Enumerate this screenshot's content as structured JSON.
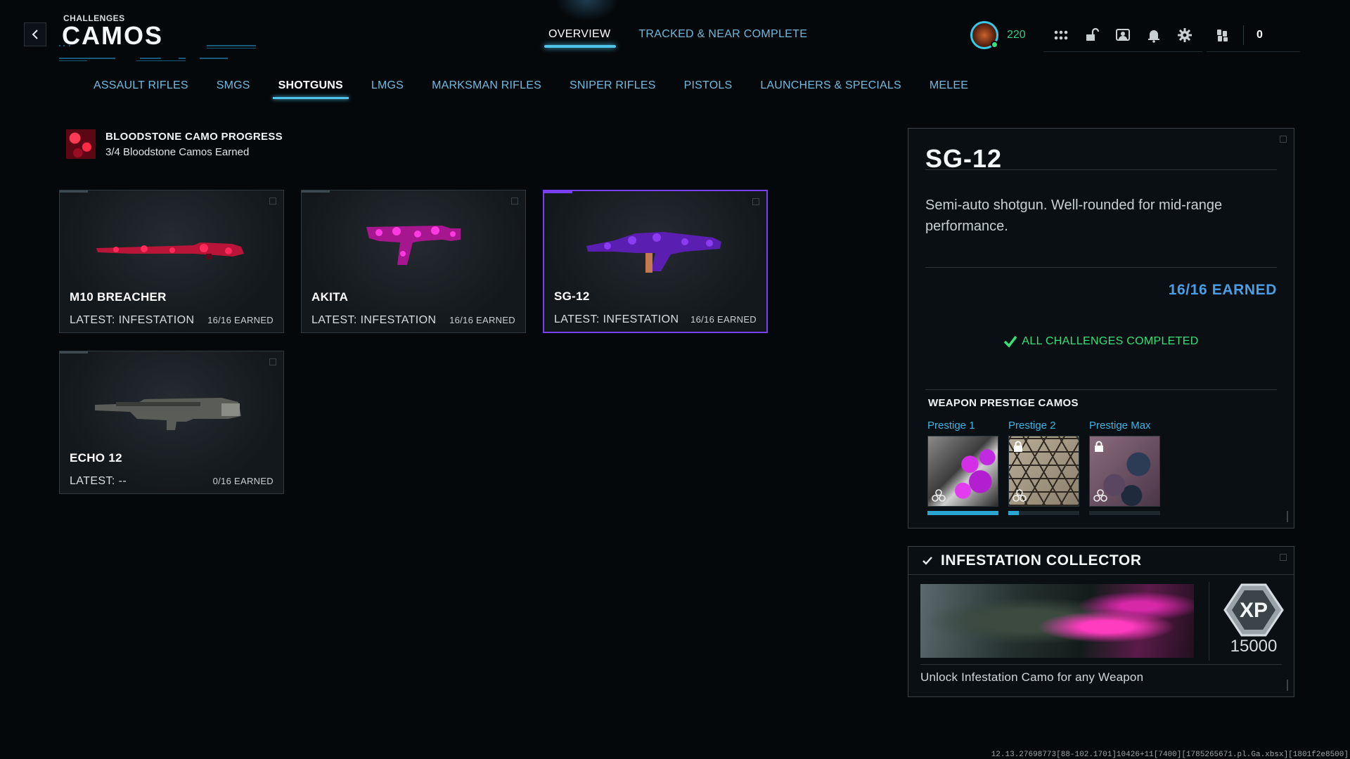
{
  "header": {
    "breadcrumb": "CHALLENGES",
    "title": "CAMOS",
    "tabs": [
      {
        "label": "OVERVIEW",
        "active": true
      },
      {
        "label": "TRACKED & NEAR COMPLETE",
        "active": false
      }
    ],
    "player_level": "220",
    "currency_amount": "0",
    "icons": [
      "grid-menu-icon",
      "unlock-icon",
      "social-icon",
      "notification-bell-icon",
      "gear-icon",
      "currency-icon"
    ]
  },
  "categories": [
    {
      "label": "ASSAULT RIFLES",
      "active": false
    },
    {
      "label": "SMGS",
      "active": false
    },
    {
      "label": "SHOTGUNS",
      "active": true
    },
    {
      "label": "LMGS",
      "active": false
    },
    {
      "label": "MARKSMAN RIFLES",
      "active": false
    },
    {
      "label": "SNIPER RIFLES",
      "active": false
    },
    {
      "label": "PISTOLS",
      "active": false
    },
    {
      "label": "LAUNCHERS & SPECIALS",
      "active": false
    },
    {
      "label": "MELEE",
      "active": false
    }
  ],
  "progress": {
    "title": "BLOODSTONE CAMO PROGRESS",
    "subtitle": "3/4 Bloodstone Camos Earned"
  },
  "weapons": [
    {
      "name": "M10 BREACHER",
      "latest": "LATEST: INFESTATION",
      "earned": "16/16 EARNED",
      "selected": false
    },
    {
      "name": "AKITA",
      "latest": "LATEST: INFESTATION",
      "earned": "16/16 EARNED",
      "selected": false
    },
    {
      "name": "SG-12",
      "latest": "LATEST: INFESTATION",
      "earned": "16/16 EARNED",
      "selected": true
    },
    {
      "name": "ECHO 12",
      "latest": "LATEST: --",
      "earned": "0/16 EARNED",
      "selected": false
    }
  ],
  "detail": {
    "name": "SG-12",
    "description": "Semi-auto shotgun. Well-rounded for mid-range performance.",
    "earned": "16/16 EARNED",
    "status": "ALL CHALLENGES COMPLETED",
    "prestige_title": "WEAPON PRESTIGE CAMOS",
    "prestige": [
      {
        "label": "Prestige 1",
        "locked": false,
        "progress": 1.0
      },
      {
        "label": "Prestige 2",
        "locked": true,
        "progress": 0.15
      },
      {
        "label": "Prestige Max",
        "locked": true,
        "progress": 0.0
      }
    ]
  },
  "reward": {
    "title": "INFESTATION COLLECTOR",
    "xp": "15000",
    "description": "Unlock Infestation Camo for any Weapon"
  },
  "build_info": "12.13.27698773[88-102.1701]10426+11[7400][1785265671.pl.Ga.xbsx][1801f2e8500]",
  "colors": {
    "accent": "#4fc3e8",
    "selected_border": "#7a3ff0",
    "earned": "#4a9ee6",
    "complete": "#36e07a"
  }
}
